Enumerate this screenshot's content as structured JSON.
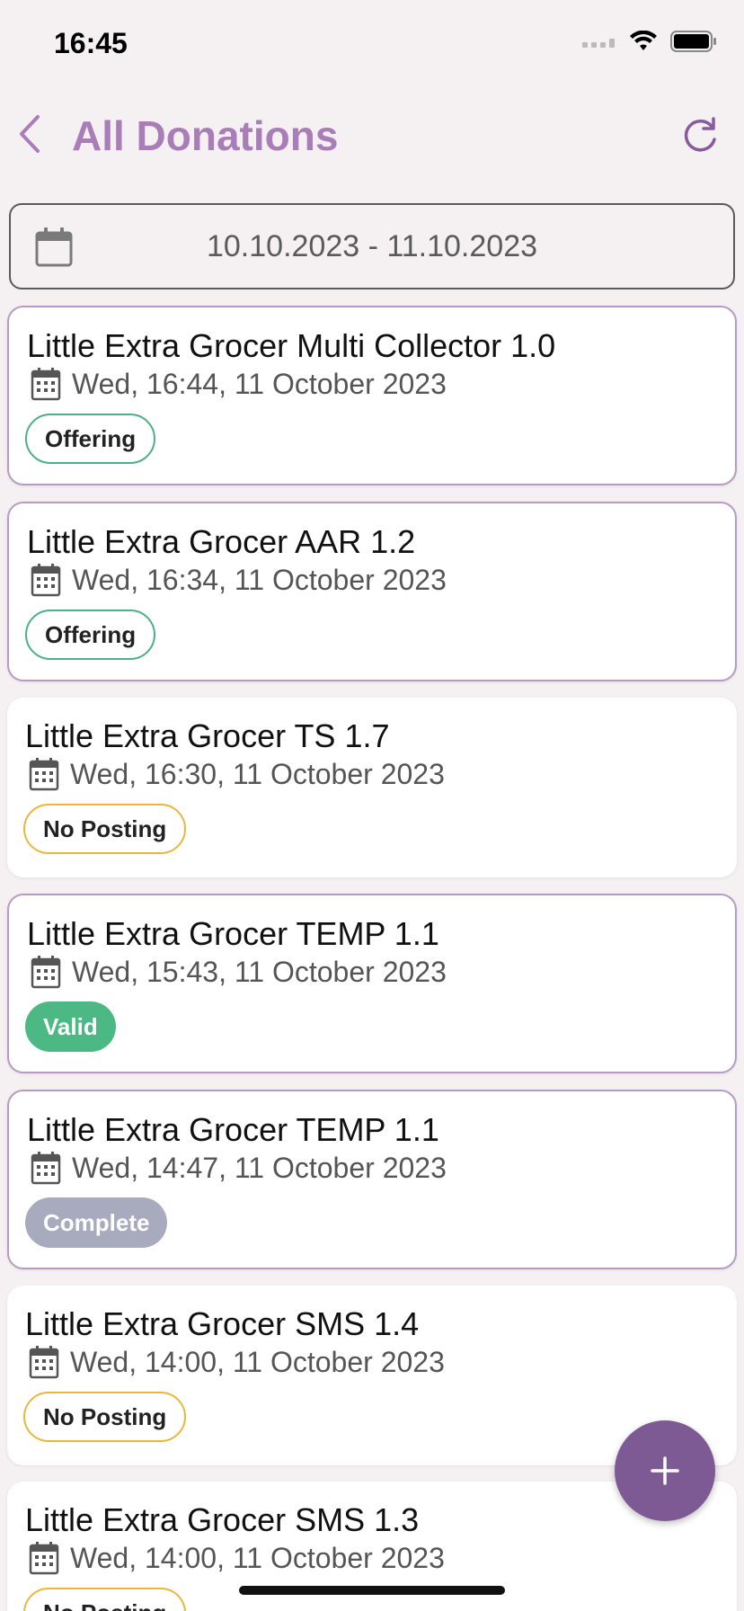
{
  "status": {
    "time": "16:45"
  },
  "nav": {
    "title": "All Donations"
  },
  "date_range": {
    "value": "10.10.2023 - 11.10.2023"
  },
  "donations": [
    {
      "title": "Little Extra Grocer Multi Collector 1.0",
      "date": "Wed, 16:44, 11 October 2023",
      "status": "Offering",
      "status_type": "offering",
      "highlighted": true
    },
    {
      "title": "Little Extra Grocer AAR 1.2",
      "date": "Wed, 16:34, 11 October 2023",
      "status": "Offering",
      "status_type": "offering",
      "highlighted": true
    },
    {
      "title": "Little Extra Grocer TS 1.7",
      "date": "Wed, 16:30, 11 October 2023",
      "status": "No Posting",
      "status_type": "noposting",
      "highlighted": false
    },
    {
      "title": "Little Extra Grocer TEMP 1.1",
      "date": "Wed, 15:43, 11 October 2023",
      "status": "Valid",
      "status_type": "valid",
      "highlighted": true
    },
    {
      "title": "Little Extra Grocer TEMP 1.1",
      "date": "Wed, 14:47, 11 October 2023",
      "status": "Complete",
      "status_type": "complete",
      "highlighted": true
    },
    {
      "title": "Little Extra Grocer SMS 1.4",
      "date": "Wed, 14:00, 11 October 2023",
      "status": "No Posting",
      "status_type": "noposting",
      "highlighted": false
    },
    {
      "title": "Little Extra Grocer SMS 1.3",
      "date": "Wed, 14:00, 11 October 2023",
      "status": "No Posting",
      "status_type": "noposting",
      "highlighted": false
    }
  ],
  "icons": {
    "back": "chevron-left-icon",
    "refresh": "refresh-icon",
    "calendar": "calendar-icon",
    "add": "plus-icon"
  },
  "colors": {
    "accent": "#a87db8",
    "fab": "#7d5a93",
    "offering": "#4caf88",
    "no_posting": "#eab73c",
    "valid": "#4cb985",
    "complete": "#a8abbd"
  }
}
